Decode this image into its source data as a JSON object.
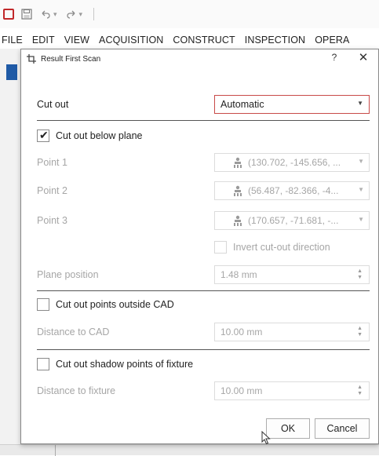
{
  "quick_access": {
    "icons": [
      "search-icon",
      "save-icon",
      "undo-icon",
      "redo-icon"
    ]
  },
  "menu": {
    "items": [
      "FILE",
      "EDIT",
      "VIEW",
      "ACQUISITION",
      "CONSTRUCT",
      "INSPECTION",
      "OPERA"
    ]
  },
  "dialog": {
    "title": "Result First Scan",
    "help_label": "?",
    "close_label": "✕",
    "cut_out": {
      "label": "Cut out",
      "value": "Automatic"
    },
    "cut_below_plane": {
      "label": "Cut out below plane",
      "checked": true
    },
    "points": [
      {
        "label": "Point 1",
        "value": "(130.702, -145.656, ..."
      },
      {
        "label": "Point 2",
        "value": "(56.487, -82.366, -4..."
      },
      {
        "label": "Point 3",
        "value": "(170.657, -71.681, -..."
      }
    ],
    "invert": {
      "label": "Invert cut-out direction",
      "checked": false
    },
    "plane_position": {
      "label": "Plane position",
      "value": "1.48 mm"
    },
    "cut_outside_cad": {
      "label": "Cut out points outside CAD",
      "checked": false
    },
    "distance_cad": {
      "label": "Distance to CAD",
      "value": "10.00 mm"
    },
    "cut_shadow": {
      "label": "Cut out shadow points of fixture",
      "checked": false
    },
    "distance_fixture": {
      "label": "Distance to fixture",
      "value": "10.00 mm"
    },
    "ok_label": "OK",
    "cancel_label": "Cancel"
  },
  "colors": {
    "accent": "#c84a48",
    "disabled_text": "#a6a6a6",
    "point_arrow": "#d06a6a"
  }
}
